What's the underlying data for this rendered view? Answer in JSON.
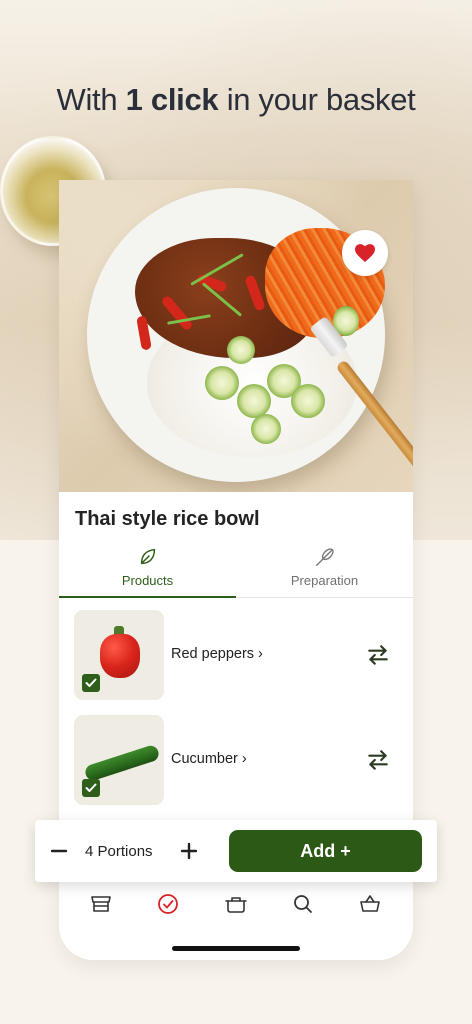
{
  "headline": {
    "prefix": "With",
    "bold": "1 click",
    "suffix": "in your basket"
  },
  "recipe": {
    "title": "Thai style rice bowl",
    "favorite_icon": "heart-icon",
    "accent_color": "#d8232a"
  },
  "tabs": [
    {
      "label": "Products",
      "icon": "leaf-icon",
      "active": true
    },
    {
      "label": "Preparation",
      "icon": "whisk-icon",
      "active": false
    }
  ],
  "ingredients": [
    {
      "name": "Red peppers ›",
      "checked": true,
      "swap_icon": "swap-arrows-icon"
    },
    {
      "name": "Cucumber ›",
      "checked": true,
      "swap_icon": "swap-arrows-icon"
    }
  ],
  "basket_bar": {
    "minus_icon": "minus-icon",
    "portions": "4 Portions",
    "plus_icon": "plus-icon",
    "add_label": "Add +",
    "button_color": "#2c5a16"
  },
  "bottom_nav": [
    {
      "icon": "store-icon",
      "active": false
    },
    {
      "icon": "check-circle-icon",
      "active": true
    },
    {
      "icon": "cooking-pot-icon",
      "active": false
    },
    {
      "icon": "search-icon",
      "active": false
    },
    {
      "icon": "basket-icon",
      "active": false
    }
  ],
  "colors": {
    "brand_green": "#2e5e1a",
    "nav_active": "#d8232a"
  }
}
